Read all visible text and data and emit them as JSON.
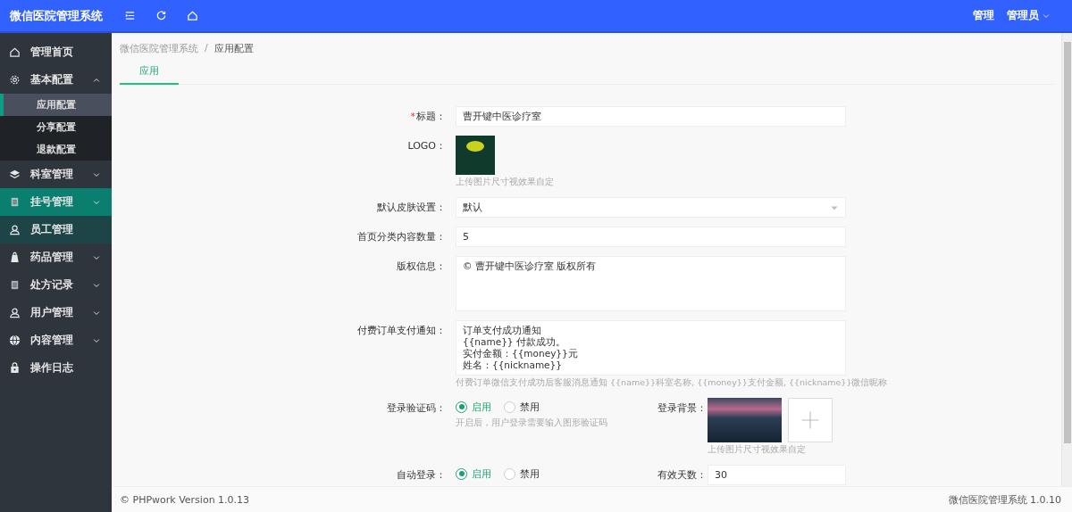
{
  "header": {
    "title": "微信医院管理系统",
    "nav": "管理",
    "user": "管理员"
  },
  "sidebar": {
    "items": [
      {
        "label": "管理首页",
        "kind": "link",
        "selected": false,
        "hovered": false
      },
      {
        "label": "基本配置",
        "kind": "group",
        "expanded": true,
        "selected": false,
        "hovered": false,
        "children": [
          {
            "label": "应用配置",
            "selected": true
          },
          {
            "label": "分享配置",
            "selected": false
          },
          {
            "label": "退款配置",
            "selected": false
          }
        ]
      },
      {
        "label": "科室管理",
        "kind": "group",
        "expanded": false,
        "selected": false,
        "hovered": false
      },
      {
        "label": "挂号管理",
        "kind": "group",
        "expanded": false,
        "selected": true,
        "hovered": false
      },
      {
        "label": "员工管理",
        "kind": "link",
        "selected": false,
        "hovered": true
      },
      {
        "label": "药品管理",
        "kind": "group",
        "expanded": false,
        "selected": false,
        "hovered": false
      },
      {
        "label": "处方记录",
        "kind": "group",
        "expanded": false,
        "selected": false,
        "hovered": false
      },
      {
        "label": "用户管理",
        "kind": "group",
        "expanded": false,
        "selected": false,
        "hovered": false
      },
      {
        "label": "内容管理",
        "kind": "group",
        "expanded": false,
        "selected": false,
        "hovered": false
      },
      {
        "label": "操作日志",
        "kind": "link",
        "selected": false,
        "hovered": false
      }
    ]
  },
  "breadcrumb": {
    "items": [
      "微信医院管理系统",
      "应用配置"
    ],
    "separator": "/"
  },
  "tabs": [
    {
      "label": "应用",
      "selected": true
    }
  ],
  "form": {
    "rows": [
      {
        "kind": "text",
        "label": "标题：",
        "required_mark": "*",
        "value": "曹开键中医诊疗室"
      },
      {
        "kind": "image",
        "label": "LOGO：",
        "hint": "上传图片尺寸视效果自定"
      },
      {
        "kind": "select",
        "label": "默认皮肤设置：",
        "value": "默认"
      },
      {
        "kind": "text",
        "label": "首页分类内容数量：",
        "value": "5"
      },
      {
        "kind": "textarea",
        "label": "版权信息：",
        "lines": [
          "© 曹开键中医诊疗室 版权所有"
        ]
      },
      {
        "kind": "textarea",
        "label": "付费订单支付通知：",
        "lines": [
          "订单支付成功通知",
          "{{name}} 付款成功。",
          "实付金额：{{money}}元",
          "姓名：{{nickname}}"
        ],
        "hint": "付费订单微信支付成功后客服消息通知 {{name}}科室名称, {{money}}支付金额, {{nickname}}微信昵称"
      },
      {
        "kind": "split",
        "left": {
          "kind": "radio",
          "label": "登录验证码：",
          "options": [
            {
              "label": "启用",
              "selected": true
            },
            {
              "label": "禁用",
              "selected": false
            }
          ],
          "hint": "开启后，用户登录需要输入图形验证码"
        },
        "right": {
          "kind": "upload",
          "label": "登录背景：",
          "hint": "上传图片尺寸视效果自定"
        }
      },
      {
        "kind": "split",
        "left": {
          "kind": "radio",
          "label": "自动登录：",
          "options": [
            {
              "label": "启用",
              "selected": true
            },
            {
              "label": "禁用",
              "selected": false
            }
          ]
        },
        "right": {
          "kind": "text",
          "label": "有效天数：",
          "value": "30"
        }
      }
    ]
  },
  "footer": {
    "left": "© PHPwork Version 1.0.13",
    "right": "微信医院管理系统 1.0.10"
  }
}
